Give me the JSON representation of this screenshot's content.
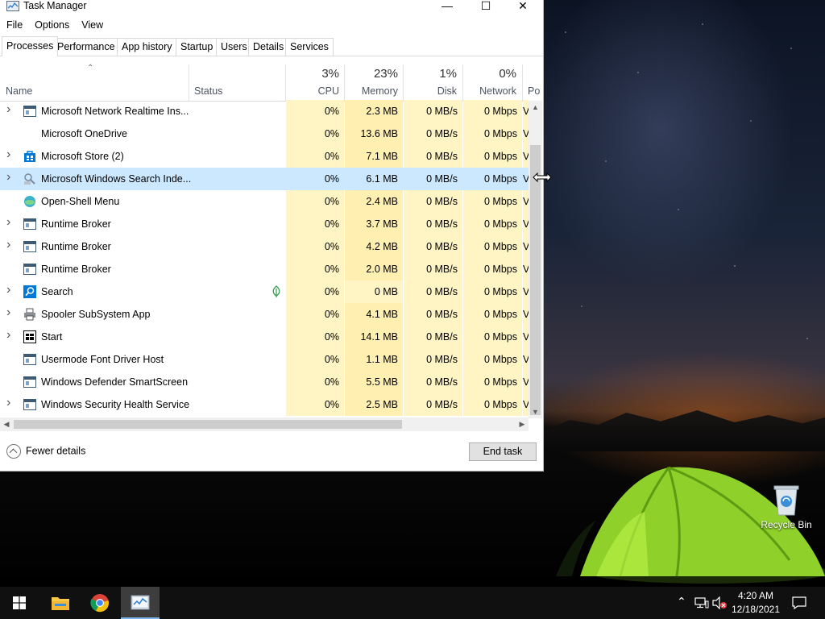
{
  "window": {
    "title": "Task Manager",
    "controls": {
      "minimize": "—",
      "maximize": "☐",
      "close": "✕"
    }
  },
  "menu": [
    "File",
    "Options",
    "View"
  ],
  "tabs": [
    "Processes",
    "Performance",
    "App history",
    "Startup",
    "Users",
    "Details",
    "Services"
  ],
  "active_tab": "Processes",
  "columns": {
    "name": "Name",
    "status": "Status",
    "cpu": {
      "pct": "3%",
      "label": "CPU"
    },
    "memory": {
      "pct": "23%",
      "label": "Memory"
    },
    "disk": {
      "pct": "1%",
      "label": "Disk"
    },
    "network": {
      "pct": "0%",
      "label": "Network"
    },
    "power": {
      "label": "Po"
    }
  },
  "processes": [
    {
      "name": "Microsoft Network Realtime Ins...",
      "expand": true,
      "icon": "app-window-icon",
      "cpu": "0%",
      "memory": "2.3 MB",
      "disk": "0 MB/s",
      "network": "0 Mbps",
      "power": "V"
    },
    {
      "name": "Microsoft OneDrive",
      "expand": false,
      "icon": "none",
      "cpu": "0%",
      "memory": "13.6 MB",
      "disk": "0 MB/s",
      "network": "0 Mbps",
      "power": "V"
    },
    {
      "name": "Microsoft Store (2)",
      "expand": true,
      "icon": "store-bag-icon",
      "cpu": "0%",
      "memory": "7.1 MB",
      "disk": "0 MB/s",
      "network": "0 Mbps",
      "power": "V"
    },
    {
      "name": "Microsoft Windows Search Inde...",
      "expand": true,
      "icon": "search-indexer-icon",
      "cpu": "0%",
      "memory": "6.1 MB",
      "disk": "0 MB/s",
      "network": "0 Mbps",
      "power": "V",
      "selected": true
    },
    {
      "name": "Open-Shell Menu",
      "expand": false,
      "icon": "shell-globe-icon",
      "cpu": "0%",
      "memory": "2.4 MB",
      "disk": "0 MB/s",
      "network": "0 Mbps",
      "power": "V"
    },
    {
      "name": "Runtime Broker",
      "expand": true,
      "icon": "app-window-icon",
      "cpu": "0%",
      "memory": "3.7 MB",
      "disk": "0 MB/s",
      "network": "0 Mbps",
      "power": "V"
    },
    {
      "name": "Runtime Broker",
      "expand": true,
      "icon": "app-window-icon",
      "cpu": "0%",
      "memory": "4.2 MB",
      "disk": "0 MB/s",
      "network": "0 Mbps",
      "power": "V"
    },
    {
      "name": "Runtime Broker",
      "expand": false,
      "icon": "app-window-icon",
      "cpu": "0%",
      "memory": "2.0 MB",
      "disk": "0 MB/s",
      "network": "0 Mbps",
      "power": "V"
    },
    {
      "name": "Search",
      "expand": true,
      "icon": "search-app-icon",
      "cpu": "0%",
      "memory": "0 MB",
      "disk": "0 MB/s",
      "network": "0 Mbps",
      "power": "V",
      "suspended": true
    },
    {
      "name": "Spooler SubSystem App",
      "expand": true,
      "icon": "printer-icon",
      "cpu": "0%",
      "memory": "4.1 MB",
      "disk": "0 MB/s",
      "network": "0 Mbps",
      "power": "V"
    },
    {
      "name": "Start",
      "expand": true,
      "icon": "start-app-icon",
      "cpu": "0%",
      "memory": "14.1 MB",
      "disk": "0 MB/s",
      "network": "0 Mbps",
      "power": "V"
    },
    {
      "name": "Usermode Font Driver Host",
      "expand": false,
      "icon": "app-window-icon",
      "cpu": "0%",
      "memory": "1.1 MB",
      "disk": "0 MB/s",
      "network": "0 Mbps",
      "power": "V"
    },
    {
      "name": "Windows Defender SmartScreen",
      "expand": false,
      "icon": "app-window-icon",
      "cpu": "0%",
      "memory": "5.5 MB",
      "disk": "0 MB/s",
      "network": "0 Mbps",
      "power": "V"
    },
    {
      "name": "Windows Security Health Service",
      "expand": true,
      "icon": "app-window-icon",
      "cpu": "0%",
      "memory": "2.5 MB",
      "disk": "0 MB/s",
      "network": "0 Mbps",
      "power": "V"
    }
  ],
  "footer": {
    "fewer_details": "Fewer details",
    "end_task": "End task"
  },
  "desktop": {
    "recycle_bin": "Recycle Bin"
  },
  "taskbar": {
    "pinned": [
      "start-windows-icon",
      "file-explorer-icon",
      "chrome-icon",
      "task-manager-icon"
    ],
    "clock_time": "4:20 AM",
    "clock_date": "12/18/2021"
  },
  "colors": {
    "selection": "#cce8ff",
    "heat_low": "#fff4c4",
    "heat_mem": "#ffefb1",
    "taskbar": "#101010",
    "accent": "#0078d7"
  }
}
